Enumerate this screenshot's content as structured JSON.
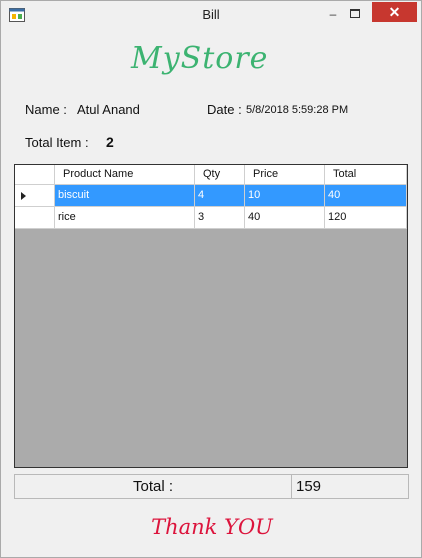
{
  "window": {
    "title": "Bill",
    "minimize_glyph": "–",
    "close_glyph": "✕"
  },
  "brand": "MyStore",
  "customer": {
    "name_label": "Name :",
    "name_value": "Atul Anand",
    "date_label": "Date :",
    "date_value": "5/8/2018 5:59:28 PM"
  },
  "summary": {
    "total_item_label": "Total Item :",
    "total_item_value": "2"
  },
  "grid": {
    "columns": [
      "Product Name",
      "Qty",
      "Price",
      "Total"
    ],
    "rows": [
      {
        "product": "biscuit",
        "qty": "4",
        "price": "10",
        "total": "40",
        "selected": true
      },
      {
        "product": "rice",
        "qty": "3",
        "price": "40",
        "total": "120",
        "selected": false
      }
    ]
  },
  "footer": {
    "total_label": "Total :",
    "total_value": "159",
    "thanks": "Thank YOU"
  },
  "colors": {
    "brand": "#3cb371",
    "thanks": "#dc143c",
    "selection": "#3399ff",
    "close_button": "#c7372f"
  },
  "icons": {
    "app": "window-app-icon",
    "row_pointer": "row-pointer-icon"
  }
}
